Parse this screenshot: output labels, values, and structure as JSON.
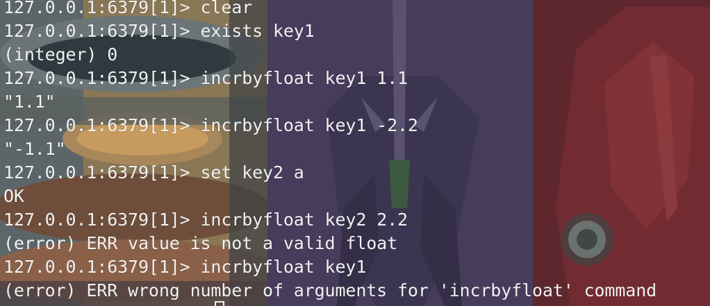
{
  "terminal": {
    "lines": [
      "127.0.0.1:6379[1]> clear",
      "127.0.0.1:6379[1]> exists key1",
      "(integer) 0",
      "127.0.0.1:6379[1]> incrbyfloat key1 1.1",
      "\"1.1\"",
      "127.0.0.1:6379[1]> incrbyfloat key1 -2.2",
      "\"-1.1\"",
      "127.0.0.1:6379[1]> set key2 a",
      "OK",
      "127.0.0.1:6379[1]> incrbyfloat key2 2.2",
      "(error) ERR value is not a valid float",
      "127.0.0.1:6379[1]> incrbyfloat key1",
      "(error) ERR wrong number of arguments for 'incrbyfloat' command"
    ]
  },
  "colors": {
    "text": "#f2f2f2",
    "panel_left": "#8c7a5a",
    "panel_middle": "#4a3f5e",
    "panel_right": "#7a2f33"
  }
}
